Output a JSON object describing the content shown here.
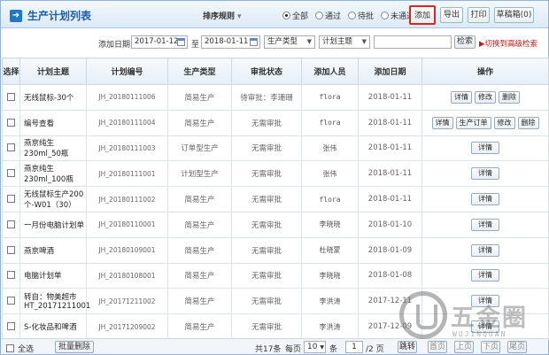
{
  "header": {
    "title": "生产计划列表",
    "sort_label": "排序规则",
    "filters": [
      {
        "label": "全部",
        "checked": true
      },
      {
        "label": "通过",
        "checked": false
      },
      {
        "label": "待批",
        "checked": false
      },
      {
        "label": "未通过",
        "checked": false
      }
    ],
    "add_label": "添加",
    "export_label": "导出",
    "print_label": "打印",
    "draft_label": "草稿箱(0)"
  },
  "search": {
    "date_label": "添加日期:",
    "date_from": "2017-01-12",
    "date_to_label": "至",
    "date_to": "2018-01-11",
    "type_placeholder": "生产类型",
    "subject_placeholder": "计划主题",
    "keyword": "",
    "search_label": "检索",
    "advanced_label": "▶切换到高级检索"
  },
  "table": {
    "columns": [
      "选择",
      "计划主题",
      "计划编号",
      "生产类型",
      "审批状态",
      "添加人员",
      "添加日期",
      "操作"
    ],
    "rows": [
      {
        "subject": "无线鼠标-30个",
        "code": "JH_20180111006",
        "type": "简易生产",
        "status": "待审批：李珊珊",
        "adder": "flora",
        "date": "2018-01-11",
        "ops": [
          "详情",
          "修改",
          "删除"
        ]
      },
      {
        "subject": "编号查看",
        "code": "JH_20180111004",
        "type": "简易生产",
        "status": "无需审批",
        "adder": "flora",
        "date": "2018-01-11",
        "ops": [
          "详情",
          "生产订单",
          "修改",
          "删除"
        ]
      },
      {
        "subject": "燕京纯生230ml_50瓶",
        "code": "JH_20180111003",
        "type": "订单型生产",
        "status": "无需审批",
        "adder": "张伟",
        "date": "2018-01-11",
        "ops": [
          "详情"
        ]
      },
      {
        "subject": "燕京纯生230ml_100瓶",
        "code": "JH_20180111001",
        "type": "计划型生产",
        "status": "无需审批",
        "adder": "张伟",
        "date": "2018-01-11",
        "ops": [
          "详情"
        ]
      },
      {
        "subject": "无线鼠标生产200个-W01（30）",
        "code": "JH_20180111002",
        "type": "简易生产",
        "status": "无需审批",
        "adder": "flora",
        "date": "2018-01-11",
        "ops": [
          "详情"
        ]
      },
      {
        "subject": "一月份电脑计划单",
        "code": "JH_20180110001",
        "type": "简易生产",
        "status": "无需审批",
        "adder": "李晓晓",
        "date": "2018-01-10",
        "ops": [
          "详情"
        ]
      },
      {
        "subject": "燕京啤酒",
        "code": "JH_20180109001",
        "type": "简易生产",
        "status": "无需审批",
        "adder": "杜晓蒙",
        "date": "2018-01-09",
        "ops": [
          "详情"
        ]
      },
      {
        "subject": "电脑计划单",
        "code": "JH_20180108001",
        "type": "简易生产",
        "status": "无需审批",
        "adder": "李晓晓",
        "date": "2018-01-08",
        "ops": [
          "详情"
        ]
      },
      {
        "subject": "转自：物美超市HT_20171211001",
        "code": "JH_20171211002",
        "type": "简易生产",
        "status": "无需审批",
        "adder": "李洪涛",
        "date": "2017-12-11",
        "ops": [
          "详情"
        ]
      },
      {
        "subject": "S-化妆品和啤酒",
        "code": "JH_20171209002",
        "type": "简易生产",
        "status": "无需审批",
        "adder": "李洪涛",
        "date": "2017-12-09",
        "ops": [
          "详情"
        ]
      }
    ]
  },
  "footer": {
    "select_all_label": "全选",
    "batch_delete_label": "批量删除",
    "total_text": "共17条",
    "per_page_label": "每页",
    "per_page_value": "10",
    "per_page_unit": "条",
    "current_page": "1",
    "total_pages_text": "/2 页",
    "go_label": "跳转",
    "first_label": "首页",
    "prev_label": "上页",
    "next_label": "下页",
    "last_label": "尾页"
  },
  "watermark": {
    "text": "五金圈",
    "sub": "WUJINQUAN"
  }
}
